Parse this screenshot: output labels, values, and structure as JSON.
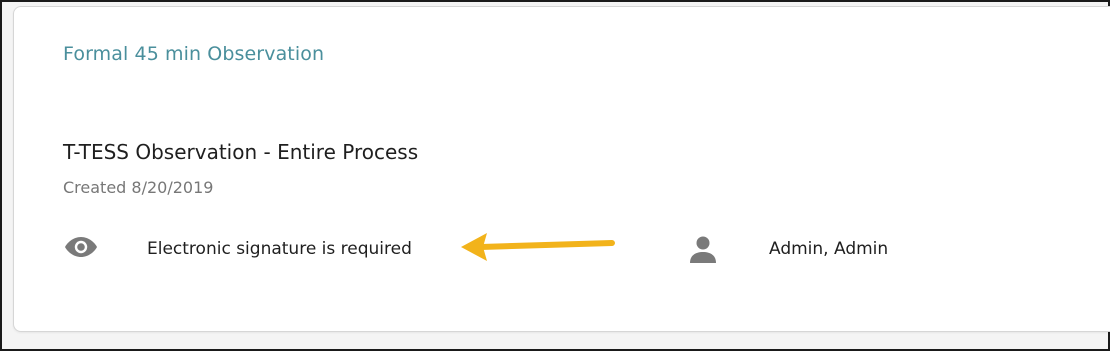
{
  "card": {
    "title": "Formal 45 min Observation"
  },
  "item": {
    "title": "T-TESS Observation - Entire Process",
    "created": "Created 8/20/2019",
    "signature_label": "Electronic signature is required",
    "owner": "Admin, Admin"
  },
  "icons": {
    "visibility": "eye-icon",
    "owner": "person-icon",
    "annotation": "arrow-icon"
  },
  "colors": {
    "title_accent": "#4a8f9c",
    "annotation_arrow": "#f2b31b",
    "icon_gray": "#7a7a7a"
  }
}
